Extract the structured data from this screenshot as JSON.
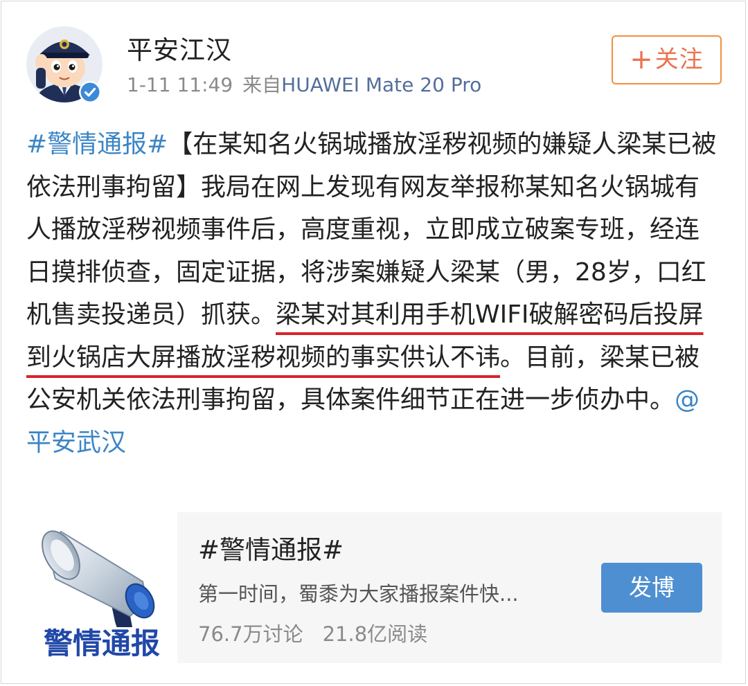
{
  "post": {
    "author": "平安江汉",
    "time": "1-11 11:49",
    "source_label": "来自",
    "device": "HUAWEI Mate 20 Pro",
    "follow_plus": "+",
    "follow_label": "关注",
    "verified_icon": "verified-badge-icon",
    "text": {
      "tag": "#警情通报#",
      "part1": "【在某知名火锅城播放淫秽视频的嫌疑人梁某已被依法刑事拘留】我局在网上发现有网友举报称某知名火锅城有人播放淫秽视频事件后，高度重视，立即成立破案专班，经连日摸排侦查，固定证据，将涉案嫌疑人梁某（男，28岁，口红机售卖投递员）抓获。",
      "underlined": "梁某对其利用手机WIFI破解密码后投屏到火锅店大屏播放淫秽视频的事实供认不讳",
      "part2": "。目前，梁某已被公安机关依法刑事拘留，具体案件细节正在进一步侦办中。",
      "mention": "@平安武汉"
    }
  },
  "topic_card": {
    "image_caption": "警情通报",
    "title": "#警情通报#",
    "description": "第一时间，蜀黍为大家播报案件快...",
    "discussions": "76.7万讨论",
    "reads": "21.8亿阅读",
    "post_button": "发博"
  },
  "colors": {
    "link": "#3b85c6",
    "follow_border": "#f0903c",
    "follow_text": "#eb7350",
    "underline": "#d6242a",
    "post_button": "#4e8fd2",
    "device_text": "#536e9c"
  }
}
